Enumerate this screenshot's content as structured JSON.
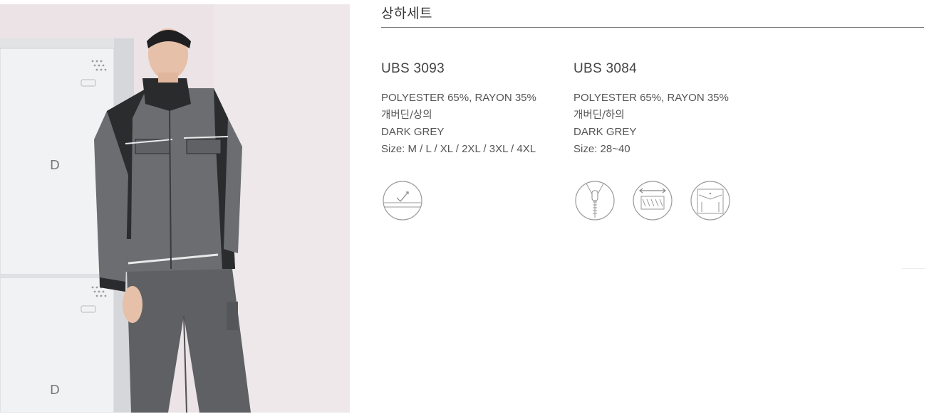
{
  "section": {
    "title": "상하세트"
  },
  "products": [
    {
      "code": "UBS 3093",
      "fabric": "POLYESTER 65%, RAYON 35%",
      "type": "개버딘/상의",
      "color": "DARK GREY",
      "size": "Size: M / L / XL / 2XL / 3XL / 4XL",
      "icons": [
        "reflective-tape-icon"
      ]
    },
    {
      "code": "UBS 3084",
      "fabric": "POLYESTER 65%, RAYON 35%",
      "type": "개버딘/하의",
      "color": "DARK GREY",
      "size": "Size: 28~40",
      "icons": [
        "zipper-icon",
        "stretch-fabric-icon",
        "cargo-pocket-icon"
      ]
    }
  ]
}
